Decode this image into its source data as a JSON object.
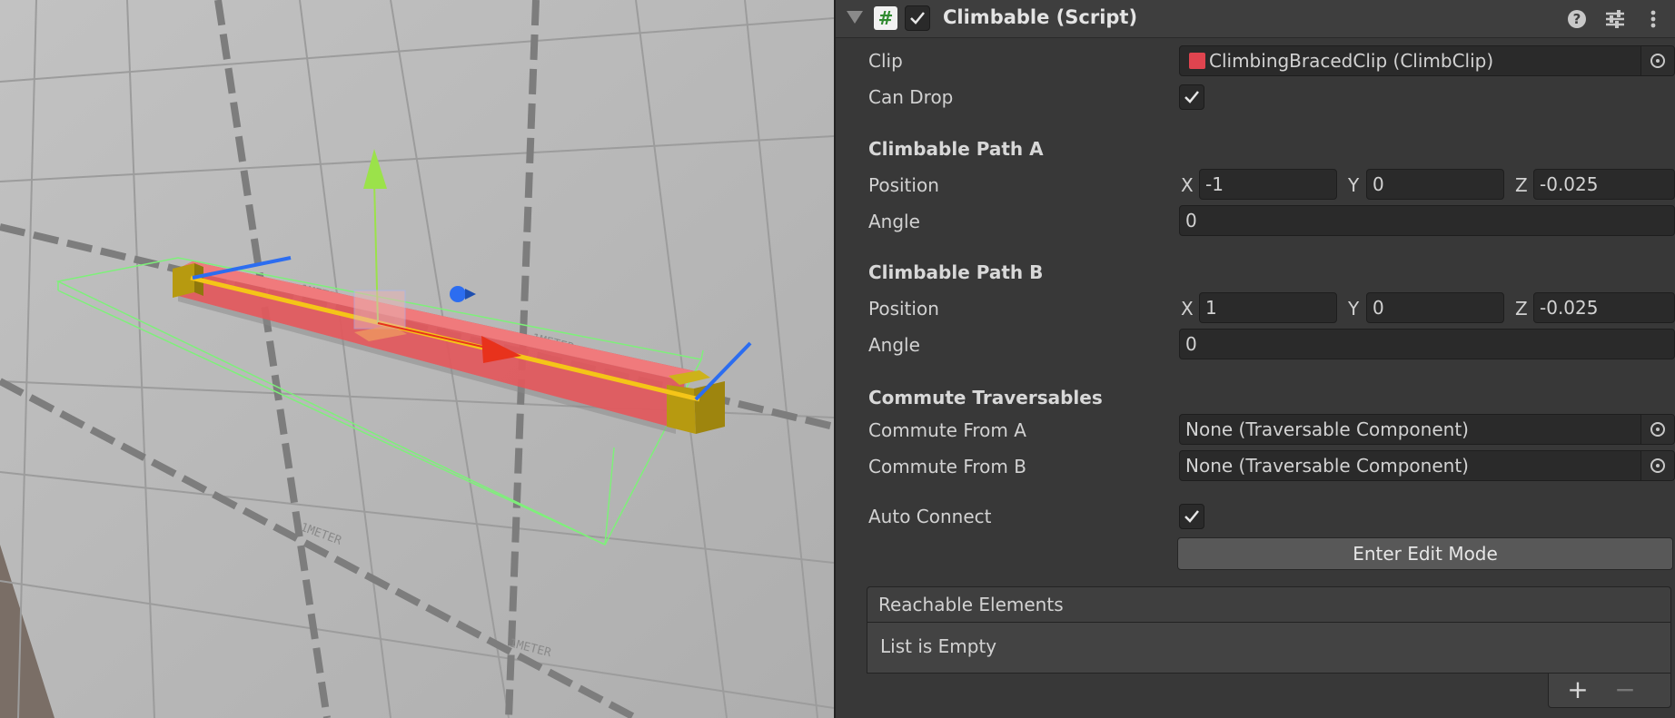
{
  "component": {
    "title": "Climbable (Script)",
    "enabled": true
  },
  "fields": {
    "clip_label": "Clip",
    "clip_value": "ClimbingBracedClip (ClimbClip)",
    "can_drop_label": "Can Drop",
    "can_drop_checked": true
  },
  "path_a": {
    "heading": "Climbable Path A",
    "position_label": "Position",
    "x_label": "X",
    "x": "-1",
    "y_label": "Y",
    "y": "0",
    "z_label": "Z",
    "z": "-0.025",
    "angle_label": "Angle",
    "angle": "0"
  },
  "path_b": {
    "heading": "Climbable Path B",
    "position_label": "Position",
    "x_label": "X",
    "x": "1",
    "y_label": "Y",
    "y": "0",
    "z_label": "Z",
    "z": "-0.025",
    "angle_label": "Angle",
    "angle": "0"
  },
  "commute": {
    "heading": "Commute Traversables",
    "from_a_label": "Commute From A",
    "from_a_value": "None (Traversable Component)",
    "from_b_label": "Commute From B",
    "from_b_value": "None (Traversable Component)"
  },
  "auto_connect": {
    "label": "Auto Connect",
    "checked": true
  },
  "edit_button": "Enter Edit Mode",
  "reachable": {
    "header": "Reachable Elements",
    "empty_text": "List is Empty",
    "add": "+",
    "remove": "−"
  },
  "scene": {
    "grid_label": "1METER",
    "colors": {
      "background": "#b9b9b9",
      "beam": "#e05a5e",
      "path_line": "#f5c518",
      "end_caps": "#b79a10",
      "gizmo_y": "#9be24a",
      "gizmo_x": "#e8321c",
      "gizmo_z": "#2c6df0",
      "bounds": "#7ef07a"
    }
  }
}
